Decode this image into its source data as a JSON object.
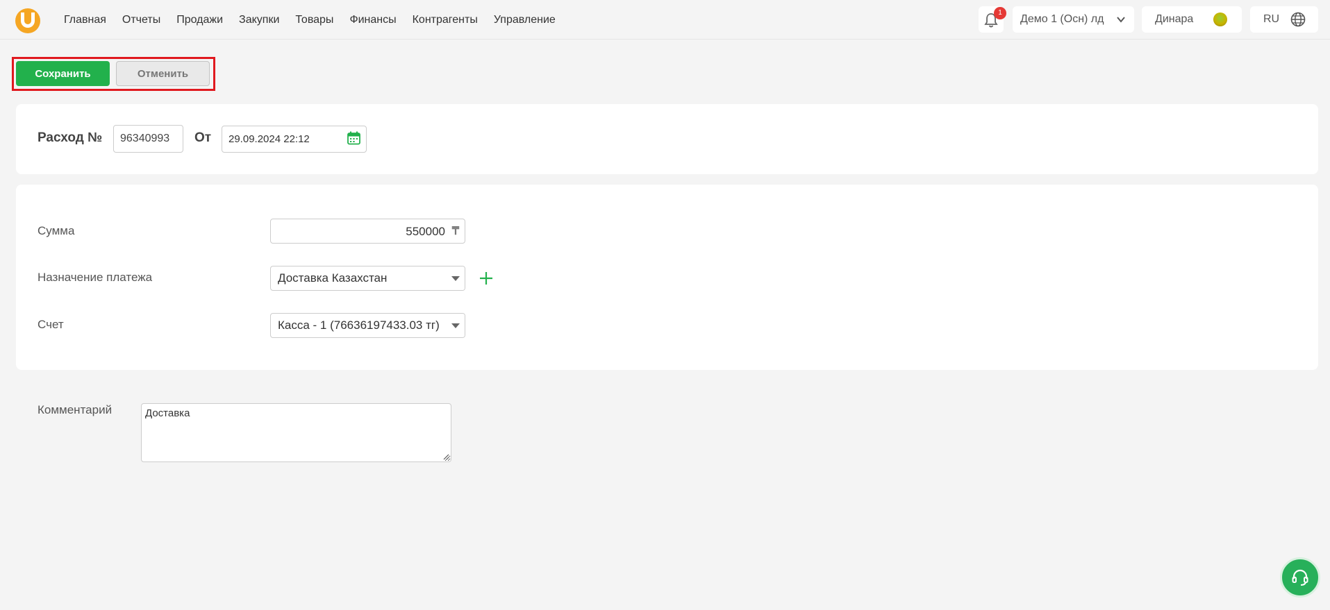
{
  "nav": {
    "items": [
      {
        "label": "Главная"
      },
      {
        "label": "Отчеты"
      },
      {
        "label": "Продажи"
      },
      {
        "label": "Закупки"
      },
      {
        "label": "Товары"
      },
      {
        "label": "Финансы"
      },
      {
        "label": "Контрагенты"
      },
      {
        "label": "Управление"
      }
    ]
  },
  "header": {
    "notification_count": "1",
    "org": "Демо 1 (Осн) лд",
    "user": "Динара",
    "lang": "RU"
  },
  "actions": {
    "save_label": "Сохранить",
    "cancel_label": "Отменить"
  },
  "doc": {
    "title_label": "Расход №",
    "number": "96340993",
    "from_label": "От",
    "date": "29.09.2024 22:12"
  },
  "form": {
    "amount_label": "Сумма",
    "amount": "550000",
    "currency_symbol": "₸",
    "purpose_label": "Назначение платежа",
    "purpose": "Доставка Казахстан",
    "account_label": "Счет",
    "account": "Касса - 1 (76636197433.03 тг)",
    "comment_label": "Комментарий",
    "comment": "Доставка"
  },
  "colors": {
    "brand": "#f5a623",
    "primary_button": "#22b14c",
    "highlight_frame": "#e0191f",
    "badge": "#e53935"
  }
}
